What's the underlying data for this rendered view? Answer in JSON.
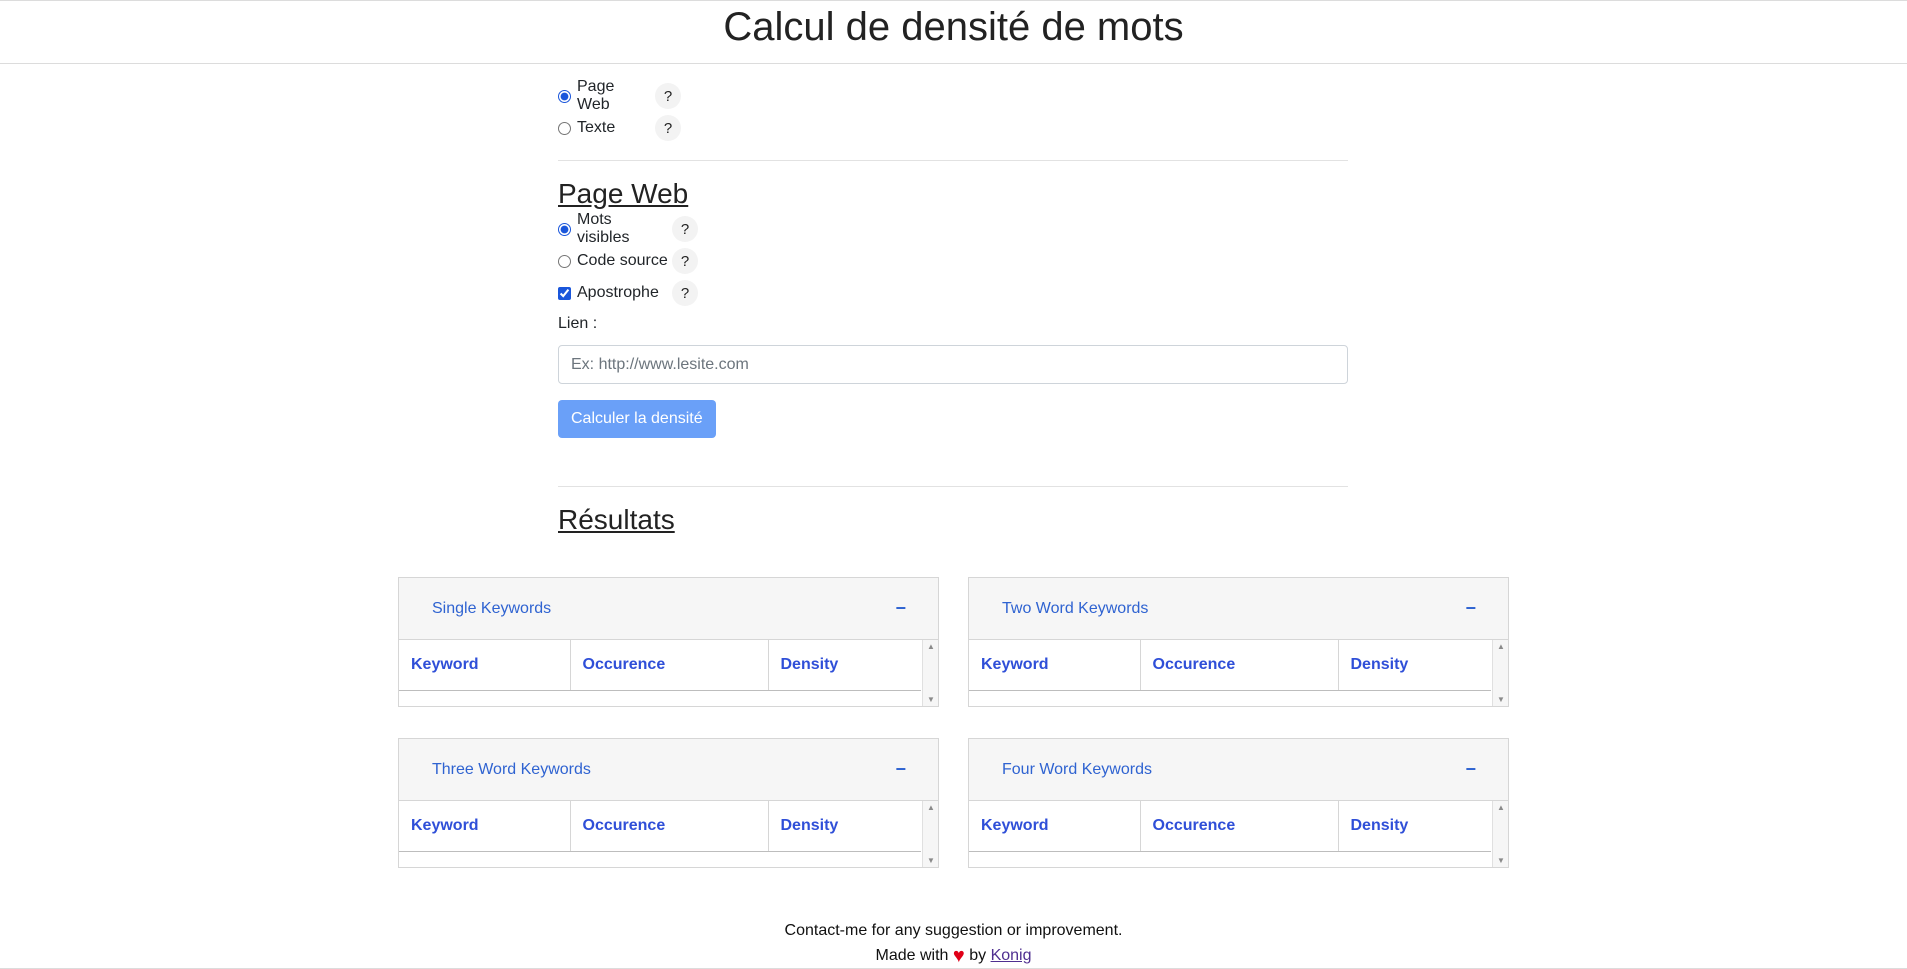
{
  "page_title": "Calcul de densité de mots",
  "mode": {
    "options": [
      {
        "label": "Page Web",
        "selected": true,
        "help": "?"
      },
      {
        "label": "Texte",
        "selected": false,
        "help": "?"
      }
    ]
  },
  "web": {
    "title": "Page Web",
    "options": [
      {
        "label": "Mots visibles",
        "type": "radio",
        "checked": true,
        "help": "?"
      },
      {
        "label": "Code source",
        "type": "radio",
        "checked": false,
        "help": "?"
      },
      {
        "label": "Apostrophe",
        "type": "checkbox",
        "checked": true,
        "help": "?"
      }
    ],
    "link_label": "Lien :",
    "link_placeholder": "Ex: http://www.lesite.com",
    "submit_label": "Calculer la densité"
  },
  "results": {
    "title": "Résultats",
    "panels": [
      {
        "title": "Single Keywords",
        "collapse": "−"
      },
      {
        "title": "Two Word Keywords",
        "collapse": "−"
      },
      {
        "title": "Three Word Keywords",
        "collapse": "−"
      },
      {
        "title": "Four Word Keywords",
        "collapse": "−"
      }
    ],
    "columns": [
      "Keyword",
      "Occurence",
      "Density"
    ]
  },
  "footer": {
    "contact": "Contact-me for any suggestion or improvement.",
    "made_with": "Made with",
    "by": "by",
    "author": "Konig"
  },
  "colors": {
    "accent": "#2f63d1",
    "button": "#6aa0f8",
    "heart": "#e00018"
  }
}
